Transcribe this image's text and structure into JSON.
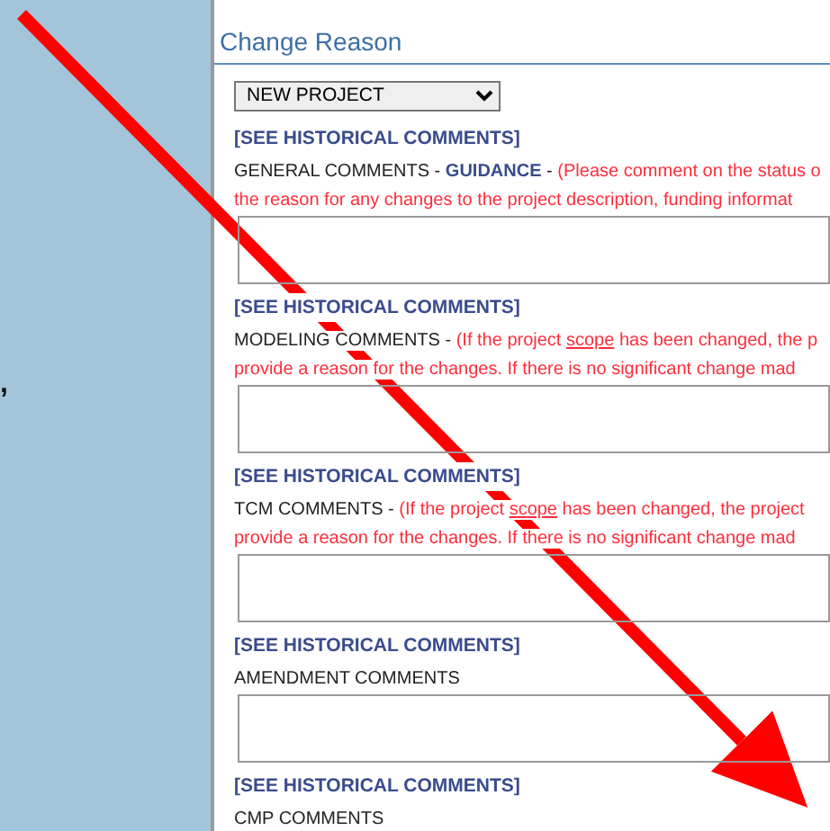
{
  "side_panel": {
    "fragment": ","
  },
  "heading": "Change Reason",
  "change_reason_select": {
    "value": "NEW PROJECT"
  },
  "sections": [
    {
      "history_link": "[SEE HISTORICAL COMMENTS]",
      "label": "GENERAL COMMENTS -",
      "guidance_link": "GUIDANCE",
      "separator": "-",
      "note_lines": [
        [
          {
            "text": "(Please comment on the status o",
            "underline": false
          }
        ],
        [
          {
            "text": "the reason for any changes to the project description, funding informat",
            "underline": false
          }
        ]
      ]
    },
    {
      "history_link": "[SEE HISTORICAL COMMENTS]",
      "label": "MODELING COMMENTS -",
      "note_lines": [
        [
          {
            "text": "(If the project ",
            "underline": false
          },
          {
            "text": "scope",
            "underline": true
          },
          {
            "text": " has been changed, the p",
            "underline": false
          }
        ],
        [
          {
            "text": "provide a reason for the changes. If there is no significant change mad",
            "underline": false
          }
        ]
      ]
    },
    {
      "history_link": "[SEE HISTORICAL COMMENTS]",
      "label": "TCM COMMENTS -",
      "note_lines": [
        [
          {
            "text": "(If the project ",
            "underline": false
          },
          {
            "text": "scope",
            "underline": true
          },
          {
            "text": " has been changed, the project",
            "underline": false
          }
        ],
        [
          {
            "text": "provide a reason for the changes. If there is no significant change mad",
            "underline": false
          }
        ]
      ]
    },
    {
      "history_link": "[SEE HISTORICAL COMMENTS]",
      "label": "AMENDMENT COMMENTS"
    },
    {
      "history_link": "[SEE HISTORICAL COMMENTS]",
      "label": "CMP COMMENTS"
    }
  ]
}
